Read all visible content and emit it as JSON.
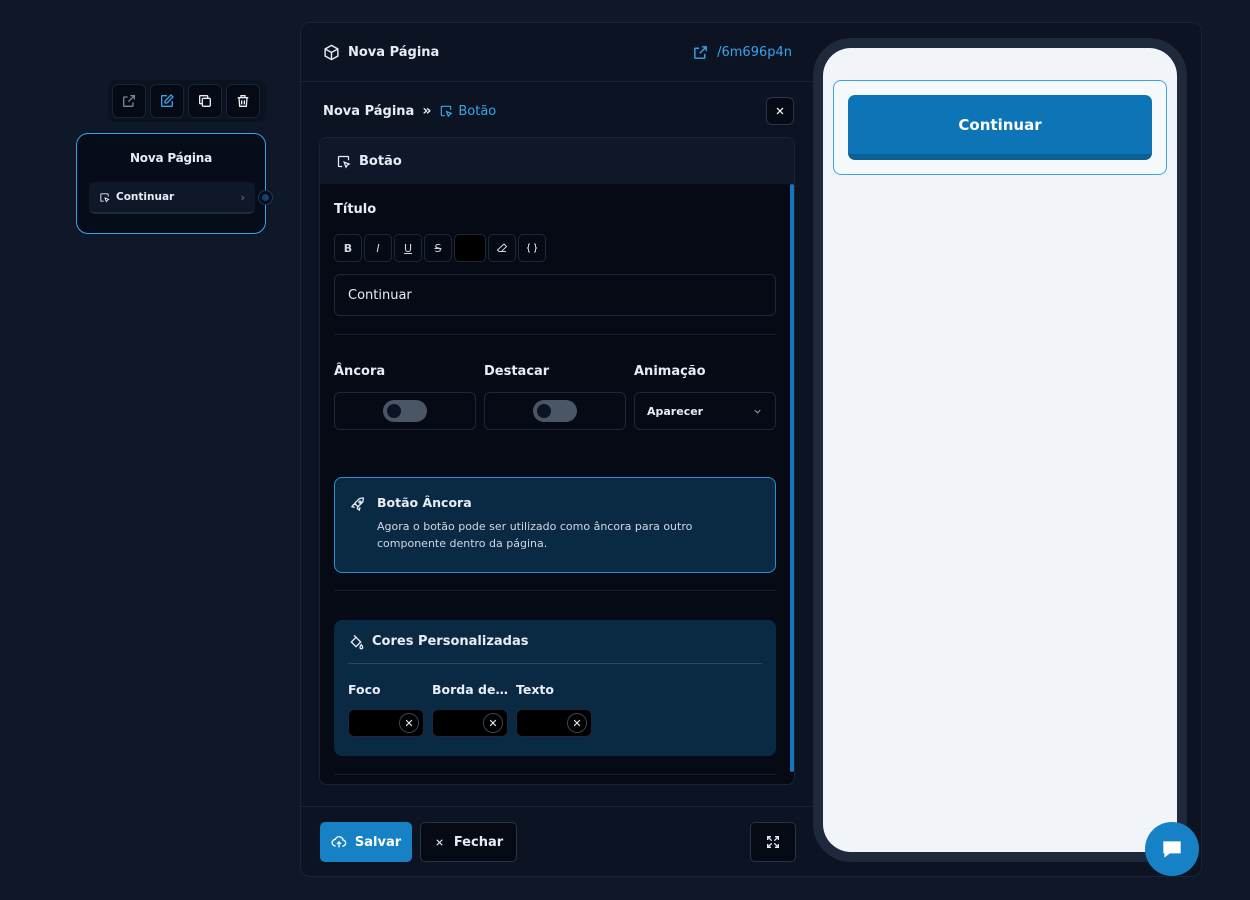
{
  "node": {
    "title": "Nova Página",
    "item_label": "Continuar",
    "toolbar": [
      "external-link-icon",
      "edit-icon",
      "copy-icon",
      "trash-icon"
    ]
  },
  "editor": {
    "header_title": "Nova Página",
    "header_link": "/6m696p4n",
    "breadcrumb_parent": "Nova Página",
    "breadcrumb_sep": "»",
    "breadcrumb_current": "Botão",
    "section_title": "Botão",
    "titulo_label": "Título",
    "format_buttons": [
      "B",
      "I",
      "U",
      "S"
    ],
    "titulo_value": "Continuar",
    "anchor_label": "Âncora",
    "highlight_label": "Destacar",
    "animation_label": "Animação",
    "animation_value": "Aparecer",
    "info_title": "Botão Âncora",
    "info_desc": "Agora o botão pode ser utilizado como âncora para outro componente dentro da página.",
    "colors_title": "Cores Personalizadas",
    "color_foco": "Foco",
    "color_borda": "Borda de...",
    "color_texto": "Texto",
    "save_label": "Salvar",
    "close_label": "Fechar"
  },
  "preview": {
    "button_label": "Continuar"
  },
  "colors": {
    "accent": "#3aa3e8",
    "primary": "#1681c4",
    "background": "#0f1829",
    "panel": "#0c1424",
    "info_bg": "#0a2a44"
  }
}
